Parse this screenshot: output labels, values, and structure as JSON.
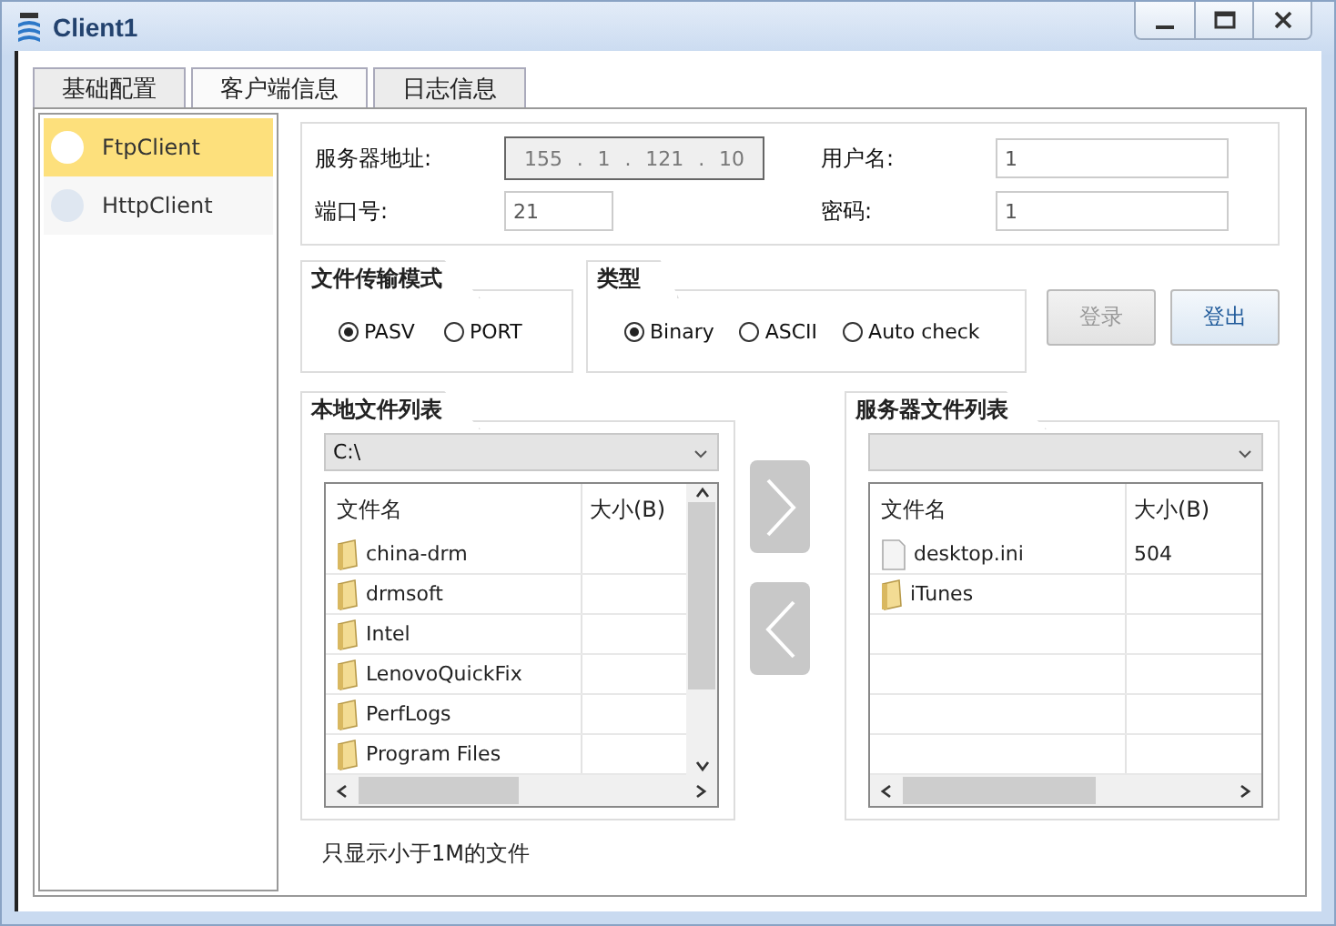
{
  "window": {
    "title": "Client1"
  },
  "tabs": [
    {
      "label": "基础配置",
      "selected": false
    },
    {
      "label": "客户端信息",
      "selected": true
    },
    {
      "label": "日志信息",
      "selected": false
    }
  ],
  "sidebar": {
    "items": [
      {
        "label": "FtpClient",
        "selected": true
      },
      {
        "label": "HttpClient",
        "selected": false
      }
    ]
  },
  "connection": {
    "server_address_label": "服务器地址:",
    "server_address": [
      "155",
      "1",
      "121",
      "10"
    ],
    "server_address_separator": ".",
    "port_label": "端口号:",
    "port": "21",
    "username_label": "用户名:",
    "username": "1",
    "password_label": "密码:",
    "password": "1"
  },
  "transfer_mode": {
    "title": "文件传输模式",
    "options": [
      {
        "label": "PASV",
        "selected": true
      },
      {
        "label": "PORT",
        "selected": false
      }
    ]
  },
  "type": {
    "title": "类型",
    "options": [
      {
        "label": "Binary",
        "selected": true
      },
      {
        "label": "ASCII",
        "selected": false
      },
      {
        "label": "Auto check",
        "selected": false
      }
    ]
  },
  "buttons": [
    {
      "label": "登录",
      "disabled": true
    },
    {
      "label": "登出",
      "disabled": false
    }
  ],
  "local_files": {
    "title": "本地文件列表",
    "path": "C:\\",
    "columns": [
      "文件名",
      "大小(B)"
    ],
    "rows": [
      {
        "kind": "folder",
        "name": "china-drm"
      },
      {
        "kind": "folder",
        "name": "drmsoft"
      },
      {
        "kind": "folder",
        "name": "Intel"
      },
      {
        "kind": "folder",
        "name": "LenovoQuickFix"
      },
      {
        "kind": "folder",
        "name": "PerfLogs"
      },
      {
        "kind": "folder",
        "name": "Program Files"
      }
    ]
  },
  "server_files": {
    "title": "服务器文件列表",
    "columns": [
      "文件名",
      "大小(B)"
    ],
    "rows": [
      {
        "kind": "file",
        "name": "desktop.ini",
        "size": "504"
      },
      {
        "kind": "folder",
        "name": "iTunes"
      }
    ]
  },
  "note": "只显示小于1M的文件"
}
